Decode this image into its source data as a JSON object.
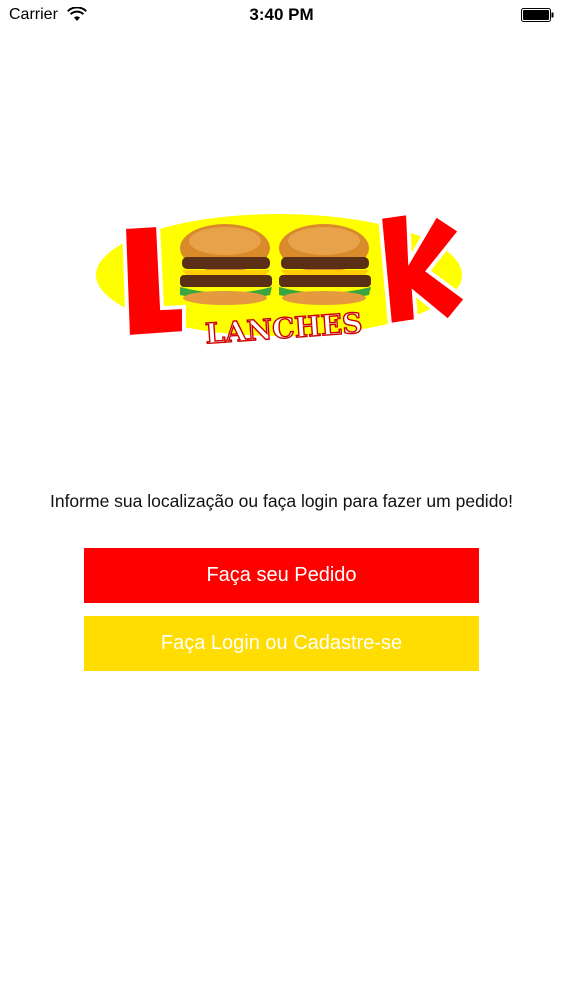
{
  "status_bar": {
    "carrier": "Carrier",
    "time": "3:40 PM",
    "icons": [
      "wifi-icon",
      "battery-icon"
    ]
  },
  "logo": {
    "text": "LOOK LANCHES",
    "icon": "burger-icon"
  },
  "main": {
    "prompt": "Informe sua localização ou faça login para fazer um pedido!",
    "order_button": "Faça seu Pedido",
    "login_button": "Faça Login ou Cadastre-se"
  },
  "colors": {
    "primary_red": "#ff0000",
    "accent_yellow": "#ffdd00",
    "background": "#ffffff"
  }
}
